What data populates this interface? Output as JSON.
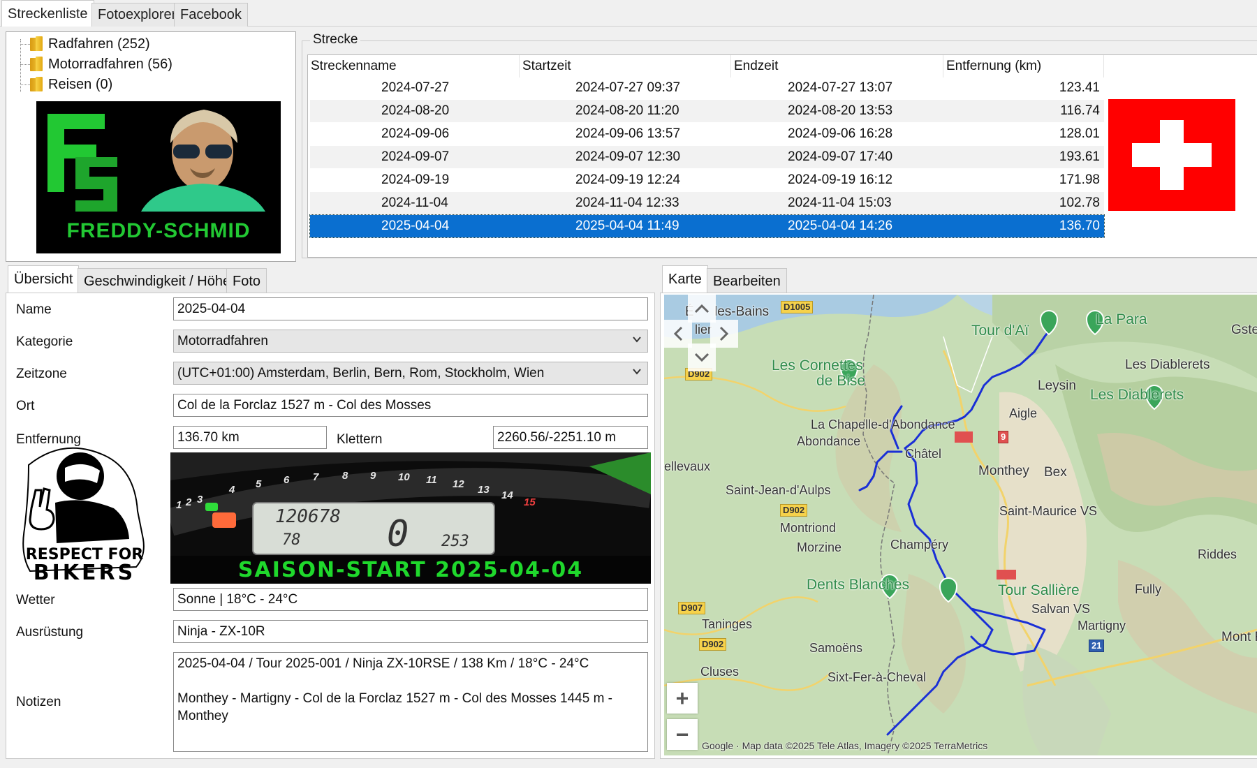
{
  "top_tabs": [
    "Streckenliste",
    "Fotoexplorer",
    "Facebook"
  ],
  "tree": [
    {
      "label": "Radfahren (252)"
    },
    {
      "label": "Motorradfahren (56)"
    },
    {
      "label": "Reisen (0)"
    }
  ],
  "logo": {
    "initials": "FS",
    "name": "FREDDY-SCHMID",
    "brand_color": "#22c833"
  },
  "strecke": {
    "group_label": "Strecke",
    "columns": [
      "Streckenname",
      "Startzeit",
      "Endzeit",
      "Entfernung (km)"
    ],
    "rows": [
      {
        "name": "2024-07-27",
        "start": "2024-07-27 09:37",
        "end": "2024-07-27 13:07",
        "distance": "123.41"
      },
      {
        "name": "2024-08-20",
        "start": "2024-08-20 11:20",
        "end": "2024-08-20 13:53",
        "distance": "116.74"
      },
      {
        "name": "2024-09-06",
        "start": "2024-09-06 13:57",
        "end": "2024-09-06 16:28",
        "distance": "128.01"
      },
      {
        "name": "2024-09-07",
        "start": "2024-09-07 12:30",
        "end": "2024-09-07 17:40",
        "distance": "193.61"
      },
      {
        "name": "2024-09-19",
        "start": "2024-09-19 12:24",
        "end": "2024-09-19 16:12",
        "distance": "171.98"
      },
      {
        "name": "2024-11-04",
        "start": "2024-11-04 12:33",
        "end": "2024-11-04 15:03",
        "distance": "102.78"
      },
      {
        "name": "2025-04-04",
        "start": "2025-04-04 11:49",
        "end": "2025-04-04 14:26",
        "distance": "136.70"
      }
    ],
    "selected_index": 6,
    "selection_color": "#0a6fd0"
  },
  "detail_tabs": [
    "Übersicht",
    "Geschwindigkeit / Höhe",
    "Foto"
  ],
  "form": {
    "name_label": "Name",
    "name": "2025-04-04",
    "kategorie_label": "Kategorie",
    "kategorie": "Motorradfahren",
    "zeitzone_label": "Zeitzone",
    "zeitzone": "(UTC+01:00) Amsterdam, Berlin, Bern, Rom, Stockholm, Wien",
    "ort_label": "Ort",
    "ort": "Col de la Forclaz 1527 m - Col des Mosses",
    "entfernung_label": "Entfernung",
    "entfernung": "136.70 km",
    "klettern_label": "Klettern",
    "klettern": "2260.56/-2251.10 m",
    "wetter_label": "Wetter",
    "wetter": "Sonne | 18°C - 24°C",
    "ausruestung_label": "Ausrüstung",
    "ausruestung": "Ninja - ZX-10R",
    "notizen_label": "Notizen",
    "notizen": "2025-04-04 / Tour 2025-001 / Ninja ZX-10RSE / 138 Km / 18°C - 24°C\n\nMonthey - Martigny - Col de la Forclaz 1527 m - Col des Mosses 1445 m - Monthey"
  },
  "sticker": {
    "line1": "RESPECT FOR",
    "line2": "BIKERS"
  },
  "dashboard": {
    "odometer": "120678",
    "trip": "78",
    "speed": "0",
    "temp": "253",
    "banner": "SAISON-START 2025-04-04",
    "tach_numbers": [
      "1",
      "2",
      "3",
      "4",
      "5",
      "6",
      "7",
      "8",
      "9",
      "10",
      "11",
      "12",
      "13",
      "14",
      "15"
    ]
  },
  "map_tabs": [
    "Karte",
    "Bearbeiten"
  ],
  "map": {
    "labels": [
      "É",
      "les-Bains",
      "lier",
      "Tour d'Aï",
      "La Para",
      "Gste",
      "Les Cornettes",
      "de Bise",
      "Leysin",
      "Les Diablerets",
      "Les Diablerets",
      "Aigle",
      "La Chapelle-d'Abondance",
      "Abondance",
      "Châtel",
      "ellevaux",
      "Monthey",
      "Bex",
      "Saint-Jean-d'Aulps",
      "Saint-Maurice VS",
      "Montriond",
      "Morzine",
      "Champéry",
      "Riddes",
      "Dents Blanches",
      "Tour Sallière",
      "Fully",
      "Salvan VS",
      "Martigny",
      "Taninges",
      "Mont F",
      "Samoëns",
      "Cluses",
      "Sixt-Fer-à-Cheval"
    ],
    "roads": [
      "D1005",
      "D902",
      "D902",
      "D907",
      "D902",
      "9",
      "21"
    ],
    "zoom_in": "+",
    "zoom_out": "−",
    "attribution": "Google · Map data ©2025 Tele Atlas, Imagery ©2025 TerraMetrics",
    "route_color": "#1a2fd6"
  }
}
